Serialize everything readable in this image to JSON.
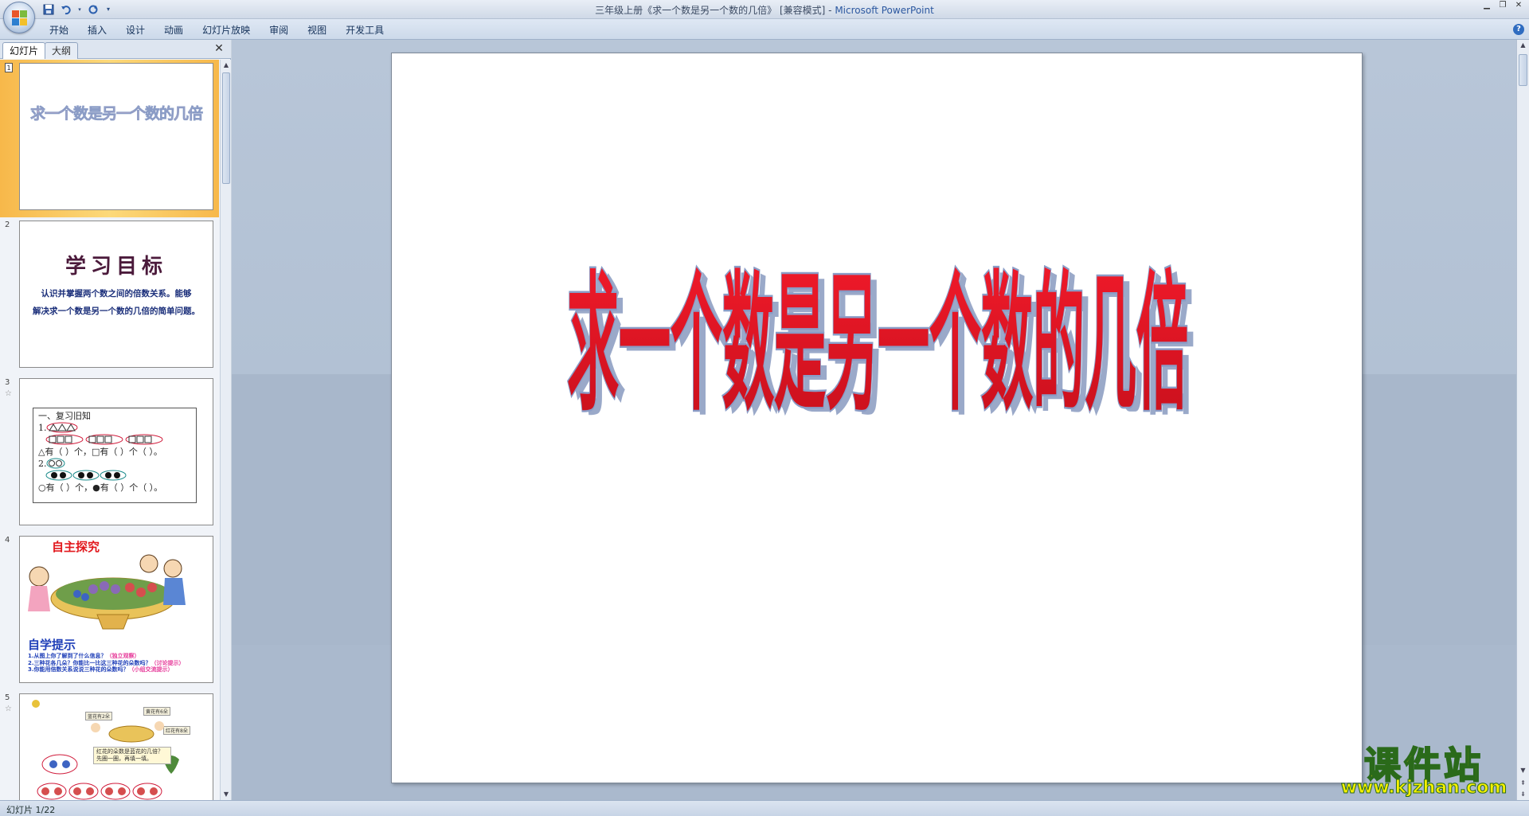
{
  "window": {
    "title_main": "三年级上册《求一个数是另一个数的几倍》 [兼容模式] - ",
    "title_app": "Microsoft PowerPoint"
  },
  "ribbon": {
    "tabs": [
      "开始",
      "插入",
      "设计",
      "动画",
      "幻灯片放映",
      "审阅",
      "视图",
      "开发工具"
    ]
  },
  "left_pane": {
    "tab_slides": "幻灯片",
    "tab_outline": "大纲"
  },
  "thumbnails": [
    {
      "number": "1",
      "title": "求一个数是另一个数的几倍"
    },
    {
      "number": "2",
      "title": "学习目标",
      "body_line1": "认识并掌握两个数之间的倍数关系。能够",
      "body_line2": "解决求一个数是另一个数的几倍的简单问题。"
    },
    {
      "number": "3",
      "heading": "一、复习旧知",
      "line_a": "△有（ ）个，□有（ ）个（ ）。",
      "item1": "1.",
      "item2": "2.",
      "line_b": "○有（ ）个，●有（ ）个（ ）。"
    },
    {
      "number": "4",
      "title": "自主探究",
      "subtitle": "自学提示",
      "line1": "1.从图上你了解到了什么信息？",
      "line1b": "（独立观察）",
      "line2": "2.三种花各几朵？你能比一比这三种花的朵数吗？",
      "line2b": "（讨论提示）",
      "line3": "3.你能用倍数关系说说三种花的朵数吗？",
      "line3b": "（小组交流提示）"
    },
    {
      "number": "5",
      "label_a": "蓝花有2朵",
      "label_b": "黄花有6朵",
      "label_c": "红花有8朵",
      "bubble": "红花的朵数是蓝花的几倍？先圈一圈，再填一填。"
    }
  ],
  "slide": {
    "title": "求一个数是另一个数的几倍"
  },
  "status": {
    "slide_counter": "幻灯片 1/22"
  },
  "watermark": {
    "name": "课件站",
    "url": "www.kjzhan.com"
  },
  "colors": {
    "title_red": "#e10f1f",
    "title_outline": "#8a9cc6",
    "selection_orange": "#f7b84a"
  }
}
